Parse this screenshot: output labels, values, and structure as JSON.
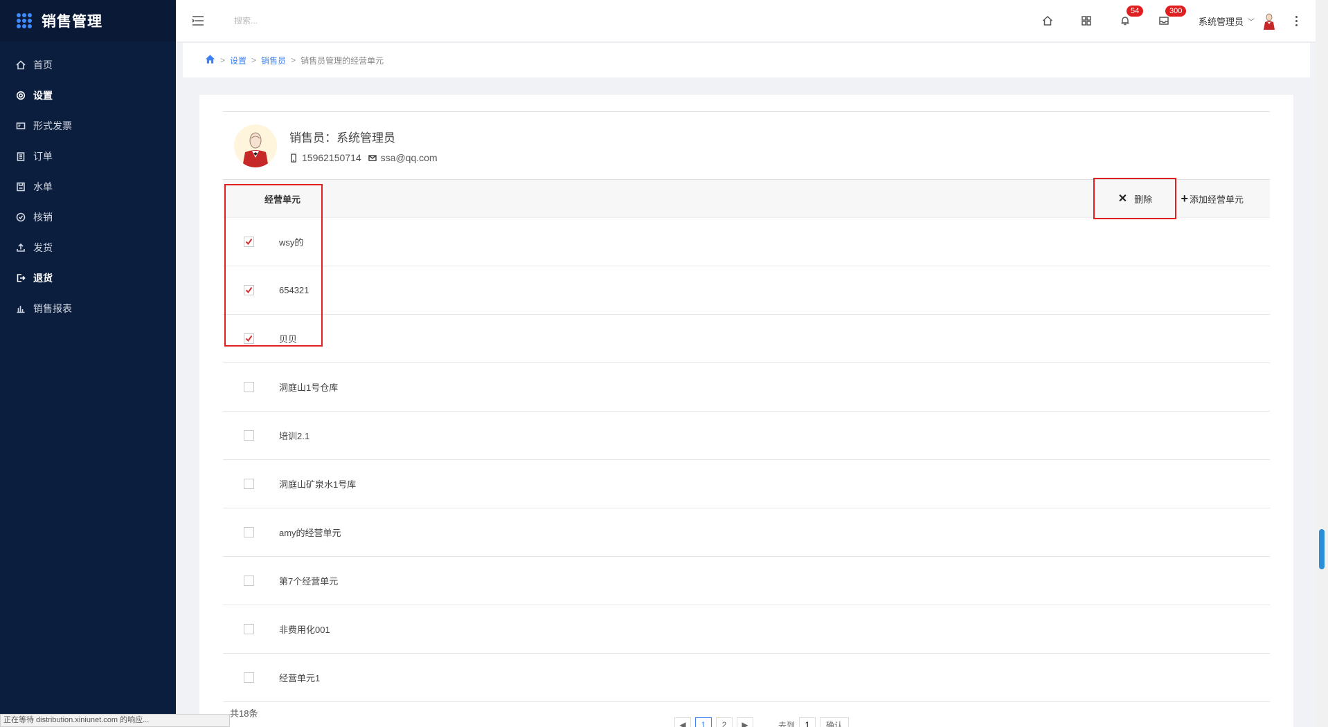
{
  "app": {
    "title": "销售管理"
  },
  "sidebar": {
    "items": [
      {
        "label": "首页",
        "icon": "home-icon",
        "active": false
      },
      {
        "label": "设置",
        "icon": "gear-icon",
        "active": true
      },
      {
        "label": "形式发票",
        "icon": "invoice-icon",
        "active": false
      },
      {
        "label": "订单",
        "icon": "clipboard-icon",
        "active": false
      },
      {
        "label": "水单",
        "icon": "save-icon",
        "active": false
      },
      {
        "label": "核销",
        "icon": "check-circle-icon",
        "active": false
      },
      {
        "label": "发货",
        "icon": "upload-icon",
        "active": false
      },
      {
        "label": "退货",
        "icon": "logout-icon",
        "active": true
      },
      {
        "label": "销售报表",
        "icon": "bar-chart-icon",
        "active": false
      }
    ]
  },
  "header": {
    "search_placeholder": "搜索...",
    "notifications_count": "54",
    "messages_count": "300",
    "user_name": "系统管理员"
  },
  "breadcrumb": {
    "items": [
      "设置",
      "销售员"
    ],
    "current": "销售员管理的经营单元"
  },
  "profile": {
    "name": "销售员：系统管理员",
    "phone": "15962150714",
    "email": "ssa@qq.com"
  },
  "table": {
    "header": "经营单元",
    "delete_label": "删除",
    "add_label": "添加经营单元",
    "rows": [
      {
        "name": "wsy的",
        "checked": true
      },
      {
        "name": "654321",
        "checked": true
      },
      {
        "name": "贝贝",
        "checked": true
      },
      {
        "name": "洞庭山1号仓库",
        "checked": false
      },
      {
        "name": "培训2.1",
        "checked": false
      },
      {
        "name": "洞庭山矿泉水1号库",
        "checked": false
      },
      {
        "name": "amy的经营单元",
        "checked": false
      },
      {
        "name": "第7个经营单元",
        "checked": false
      },
      {
        "name": "非费用化001",
        "checked": false
      },
      {
        "name": "经营单元1",
        "checked": false
      }
    ]
  },
  "pagination": {
    "total_text": "共18条",
    "pages": [
      "1",
      "2"
    ],
    "current_page": "1",
    "goto_label": "去到",
    "goto_value": "1",
    "confirm_label": "确认"
  },
  "status_bar": {
    "text": "正在等待 distribution.xiniunet.com 的响应..."
  },
  "colors": {
    "sidebar_bg": "#0c1e3d",
    "accent": "#3b82f6",
    "highlight": "#e02020",
    "check": "#d32f2f"
  }
}
